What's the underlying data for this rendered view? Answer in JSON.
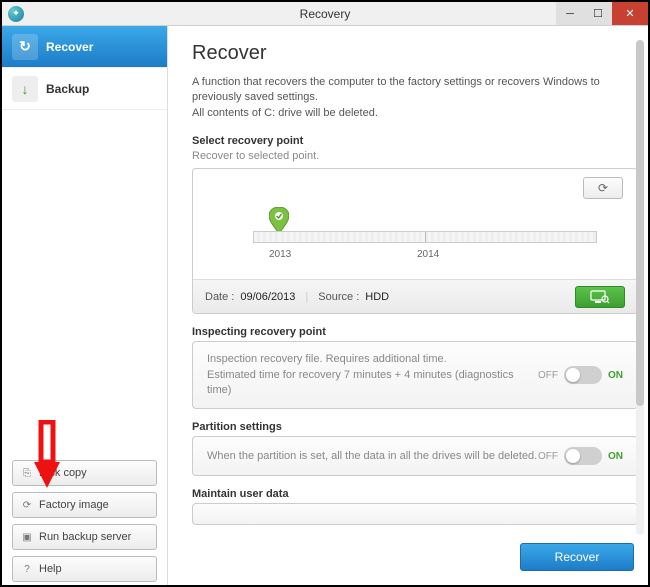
{
  "window": {
    "title": "Recovery"
  },
  "sidebar": {
    "nav": [
      {
        "label": "Recover",
        "icon": "↻"
      },
      {
        "label": "Backup",
        "icon": "↓"
      }
    ],
    "buttons": [
      {
        "label": "Disk copy"
      },
      {
        "label": "Factory image"
      },
      {
        "label": "Run backup server"
      },
      {
        "label": "Help"
      }
    ]
  },
  "main": {
    "heading": "Recover",
    "desc1": "A function that recovers the computer to the factory settings or recovers Windows to previously saved settings.",
    "desc2": "All contents of C: drive will be deleted.",
    "recovery_point": {
      "title": "Select recovery point",
      "subtitle": "Recover to selected point.",
      "years": [
        "2013",
        "2014"
      ],
      "date_label": "Date :",
      "date_value": "09/06/2013",
      "source_label": "Source :",
      "source_value": "HDD"
    },
    "inspect": {
      "title": "Inspecting recovery point",
      "line1": "Inspection recovery file. Requires additional time.",
      "line2": "Estimated time for recovery 7 minutes + 4 minutes (diagnostics time)",
      "off": "OFF",
      "on": "ON"
    },
    "partition": {
      "title": "Partition settings",
      "text": "When the partition is set, all the data in all the drives will be deleted.",
      "off": "OFF",
      "on": "ON"
    },
    "maintain": {
      "title": "Maintain user data"
    },
    "recover_btn": "Recover"
  }
}
